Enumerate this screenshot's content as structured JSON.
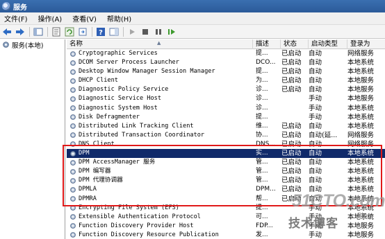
{
  "window": {
    "title": "服务"
  },
  "menu": [
    "文件(F)",
    "操作(A)",
    "查看(V)",
    "帮助(H)"
  ],
  "tree": {
    "root_label": "服务(本地)"
  },
  "columns": {
    "name": "名称",
    "description": "描述",
    "status": "状态",
    "startup": "启动类型",
    "logon": "登录为"
  },
  "services": [
    {
      "name": "Cryptographic Services",
      "desc": "提...",
      "status": "已启动",
      "startup": "自动",
      "logon": "网络服务"
    },
    {
      "name": "DCOM Server Process Launcher",
      "desc": "DCO...",
      "status": "已启动",
      "startup": "自动",
      "logon": "本地系统"
    },
    {
      "name": "Desktop Window Manager Session Manager",
      "desc": "提...",
      "status": "已启动",
      "startup": "自动",
      "logon": "本地系统"
    },
    {
      "name": "DHCP Client",
      "desc": "为...",
      "status": "已启动",
      "startup": "自动",
      "logon": "本地服务"
    },
    {
      "name": "Diagnostic Policy Service",
      "desc": "诊...",
      "status": "已启动",
      "startup": "自动",
      "logon": "本地服务"
    },
    {
      "name": "Diagnostic Service Host",
      "desc": "诊...",
      "status": "",
      "startup": "手动",
      "logon": "本地服务"
    },
    {
      "name": "Diagnostic System Host",
      "desc": "诊...",
      "status": "",
      "startup": "手动",
      "logon": "本地系统"
    },
    {
      "name": "Disk Defragmenter",
      "desc": "提...",
      "status": "",
      "startup": "手动",
      "logon": "本地系统"
    },
    {
      "name": "Distributed Link Tracking Client",
      "desc": "维...",
      "status": "已启动",
      "startup": "自动",
      "logon": "本地系统"
    },
    {
      "name": "Distributed Transaction Coordinator",
      "desc": "协...",
      "status": "已启动",
      "startup": "自动(延...",
      "logon": "网络服务"
    },
    {
      "name": "DNS Client",
      "desc": "DNS...",
      "status": "已启动",
      "startup": "自动",
      "logon": "网络服务"
    },
    {
      "name": "DPM",
      "desc": "实...",
      "status": "已启动",
      "startup": "自动",
      "logon": "本地系统"
    },
    {
      "name": "DPM AccessManager 服务",
      "desc": "管...",
      "status": "已启动",
      "startup": "自动",
      "logon": "本地系统"
    },
    {
      "name": "DPM 编写器",
      "desc": "管...",
      "status": "已启动",
      "startup": "自动",
      "logon": "本地系统"
    },
    {
      "name": "DPM 代理协调器",
      "desc": "管...",
      "status": "已启动",
      "startup": "自动",
      "logon": "本地系统"
    },
    {
      "name": "DPMLA",
      "desc": "DPM...",
      "status": "已启动",
      "startup": "自动",
      "logon": "本地系统"
    },
    {
      "name": "DPMRA",
      "desc": "帮...",
      "status": "已启动",
      "startup": "自动",
      "logon": "本地系统"
    },
    {
      "name": "Encrypting File System (EFS)",
      "desc": "提...",
      "status": "",
      "startup": "手动",
      "logon": "本地系统"
    },
    {
      "name": "Extensible Authentication Protocol",
      "desc": "可...",
      "status": "",
      "startup": "手动",
      "logon": "本地系统"
    },
    {
      "name": "Function Discovery Provider Host",
      "desc": "FDP...",
      "status": "",
      "startup": "手动",
      "logon": "本地服务"
    },
    {
      "name": "Function Discovery Resource Publication",
      "desc": "发...",
      "status": "",
      "startup": "手动",
      "logon": "本地服务"
    }
  ],
  "selected_index": 11,
  "watermark": {
    "site": "51CTO.com",
    "sub": "技术博客",
    "blog": "Blog"
  }
}
